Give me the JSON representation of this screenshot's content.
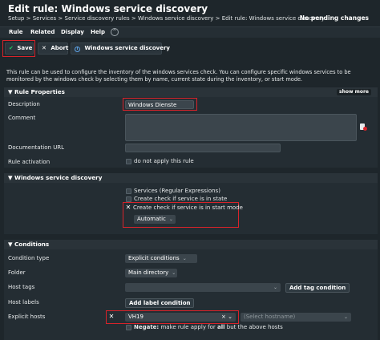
{
  "header": {
    "title": "Edit rule: Windows service discovery",
    "breadcrumb": "Setup > Services > Service discovery rules > Windows service discovery > Edit rule: Windows service discovery",
    "pending": "No pending changes"
  },
  "menu": {
    "items": [
      "Rule",
      "Related",
      "Display",
      "Help"
    ],
    "collapse_glyph": "^"
  },
  "toolbar": {
    "save": "Save",
    "abort": "Abort",
    "service": "Windows service discovery",
    "check_glyph": "✔",
    "x_glyph": "✕",
    "info_glyph": "i"
  },
  "intro": "This rule can be used to configure the inventory of the windows services check. You can configure specific windows services to be monitored by the windows check by selecting them by name, current state during the inventory, or start mode.",
  "rule_properties": {
    "heading": "▼  Rule Properties",
    "show_more": "show more",
    "description_label": "Description",
    "description_value": "Windows Dienste",
    "comment_label": "Comment",
    "doc_url_label": "Documentation URL",
    "activation_label": "Rule activation",
    "activation_text": "do not apply this rule"
  },
  "wsd": {
    "heading": "▼  Windows service discovery",
    "services_regex": "Services (Regular Expressions)",
    "check_state": "Create check if service is in state",
    "check_start_mode": "Create check if service is in start mode",
    "start_mode_value": "Automatic"
  },
  "conditions": {
    "heading": "▼  Conditions",
    "condition_type_label": "Condition type",
    "condition_type_value": "Explicit conditions",
    "folder_label": "Folder",
    "folder_value": "Main directory",
    "host_tags_label": "Host tags",
    "add_tag": "Add tag condition",
    "host_labels_label": "Host labels",
    "add_label": "Add label condition",
    "explicit_hosts_label": "Explicit hosts",
    "host_value": "VH19",
    "select_placeholder": "(Select hostname)",
    "negate_bold": "Negate:",
    "negate_text": " make rule apply for ",
    "negate_all": "all",
    "negate_but": " but ",
    "negate_the": "the",
    "negate_rest": " above hosts"
  },
  "colors": {
    "accent_green": "#1ec863",
    "highlight_red": "#d8232a",
    "background": "#1e262b"
  }
}
